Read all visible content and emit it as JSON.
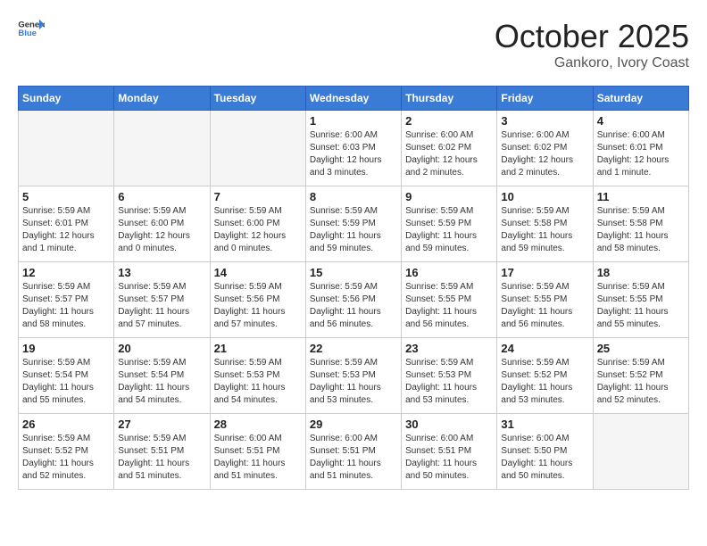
{
  "header": {
    "logo_general": "General",
    "logo_blue": "Blue",
    "month": "October 2025",
    "location": "Gankoro, Ivory Coast"
  },
  "weekdays": [
    "Sunday",
    "Monday",
    "Tuesday",
    "Wednesday",
    "Thursday",
    "Friday",
    "Saturday"
  ],
  "weeks": [
    [
      {
        "day": "",
        "sunrise": "",
        "sunset": "",
        "daylight": "",
        "empty": true
      },
      {
        "day": "",
        "sunrise": "",
        "sunset": "",
        "daylight": "",
        "empty": true
      },
      {
        "day": "",
        "sunrise": "",
        "sunset": "",
        "daylight": "",
        "empty": true
      },
      {
        "day": "1",
        "sunrise": "Sunrise: 6:00 AM",
        "sunset": "Sunset: 6:03 PM",
        "daylight": "Daylight: 12 hours and 3 minutes."
      },
      {
        "day": "2",
        "sunrise": "Sunrise: 6:00 AM",
        "sunset": "Sunset: 6:02 PM",
        "daylight": "Daylight: 12 hours and 2 minutes."
      },
      {
        "day": "3",
        "sunrise": "Sunrise: 6:00 AM",
        "sunset": "Sunset: 6:02 PM",
        "daylight": "Daylight: 12 hours and 2 minutes."
      },
      {
        "day": "4",
        "sunrise": "Sunrise: 6:00 AM",
        "sunset": "Sunset: 6:01 PM",
        "daylight": "Daylight: 12 hours and 1 minute."
      }
    ],
    [
      {
        "day": "5",
        "sunrise": "Sunrise: 5:59 AM",
        "sunset": "Sunset: 6:01 PM",
        "daylight": "Daylight: 12 hours and 1 minute."
      },
      {
        "day": "6",
        "sunrise": "Sunrise: 5:59 AM",
        "sunset": "Sunset: 6:00 PM",
        "daylight": "Daylight: 12 hours and 0 minutes."
      },
      {
        "day": "7",
        "sunrise": "Sunrise: 5:59 AM",
        "sunset": "Sunset: 6:00 PM",
        "daylight": "Daylight: 12 hours and 0 minutes."
      },
      {
        "day": "8",
        "sunrise": "Sunrise: 5:59 AM",
        "sunset": "Sunset: 5:59 PM",
        "daylight": "Daylight: 11 hours and 59 minutes."
      },
      {
        "day": "9",
        "sunrise": "Sunrise: 5:59 AM",
        "sunset": "Sunset: 5:59 PM",
        "daylight": "Daylight: 11 hours and 59 minutes."
      },
      {
        "day": "10",
        "sunrise": "Sunrise: 5:59 AM",
        "sunset": "Sunset: 5:58 PM",
        "daylight": "Daylight: 11 hours and 59 minutes."
      },
      {
        "day": "11",
        "sunrise": "Sunrise: 5:59 AM",
        "sunset": "Sunset: 5:58 PM",
        "daylight": "Daylight: 11 hours and 58 minutes."
      }
    ],
    [
      {
        "day": "12",
        "sunrise": "Sunrise: 5:59 AM",
        "sunset": "Sunset: 5:57 PM",
        "daylight": "Daylight: 11 hours and 58 minutes."
      },
      {
        "day": "13",
        "sunrise": "Sunrise: 5:59 AM",
        "sunset": "Sunset: 5:57 PM",
        "daylight": "Daylight: 11 hours and 57 minutes."
      },
      {
        "day": "14",
        "sunrise": "Sunrise: 5:59 AM",
        "sunset": "Sunset: 5:56 PM",
        "daylight": "Daylight: 11 hours and 57 minutes."
      },
      {
        "day": "15",
        "sunrise": "Sunrise: 5:59 AM",
        "sunset": "Sunset: 5:56 PM",
        "daylight": "Daylight: 11 hours and 56 minutes."
      },
      {
        "day": "16",
        "sunrise": "Sunrise: 5:59 AM",
        "sunset": "Sunset: 5:55 PM",
        "daylight": "Daylight: 11 hours and 56 minutes."
      },
      {
        "day": "17",
        "sunrise": "Sunrise: 5:59 AM",
        "sunset": "Sunset: 5:55 PM",
        "daylight": "Daylight: 11 hours and 56 minutes."
      },
      {
        "day": "18",
        "sunrise": "Sunrise: 5:59 AM",
        "sunset": "Sunset: 5:55 PM",
        "daylight": "Daylight: 11 hours and 55 minutes."
      }
    ],
    [
      {
        "day": "19",
        "sunrise": "Sunrise: 5:59 AM",
        "sunset": "Sunset: 5:54 PM",
        "daylight": "Daylight: 11 hours and 55 minutes."
      },
      {
        "day": "20",
        "sunrise": "Sunrise: 5:59 AM",
        "sunset": "Sunset: 5:54 PM",
        "daylight": "Daylight: 11 hours and 54 minutes."
      },
      {
        "day": "21",
        "sunrise": "Sunrise: 5:59 AM",
        "sunset": "Sunset: 5:53 PM",
        "daylight": "Daylight: 11 hours and 54 minutes."
      },
      {
        "day": "22",
        "sunrise": "Sunrise: 5:59 AM",
        "sunset": "Sunset: 5:53 PM",
        "daylight": "Daylight: 11 hours and 53 minutes."
      },
      {
        "day": "23",
        "sunrise": "Sunrise: 5:59 AM",
        "sunset": "Sunset: 5:53 PM",
        "daylight": "Daylight: 11 hours and 53 minutes."
      },
      {
        "day": "24",
        "sunrise": "Sunrise: 5:59 AM",
        "sunset": "Sunset: 5:52 PM",
        "daylight": "Daylight: 11 hours and 53 minutes."
      },
      {
        "day": "25",
        "sunrise": "Sunrise: 5:59 AM",
        "sunset": "Sunset: 5:52 PM",
        "daylight": "Daylight: 11 hours and 52 minutes."
      }
    ],
    [
      {
        "day": "26",
        "sunrise": "Sunrise: 5:59 AM",
        "sunset": "Sunset: 5:52 PM",
        "daylight": "Daylight: 11 hours and 52 minutes."
      },
      {
        "day": "27",
        "sunrise": "Sunrise: 5:59 AM",
        "sunset": "Sunset: 5:51 PM",
        "daylight": "Daylight: 11 hours and 51 minutes."
      },
      {
        "day": "28",
        "sunrise": "Sunrise: 6:00 AM",
        "sunset": "Sunset: 5:51 PM",
        "daylight": "Daylight: 11 hours and 51 minutes."
      },
      {
        "day": "29",
        "sunrise": "Sunrise: 6:00 AM",
        "sunset": "Sunset: 5:51 PM",
        "daylight": "Daylight: 11 hours and 51 minutes."
      },
      {
        "day": "30",
        "sunrise": "Sunrise: 6:00 AM",
        "sunset": "Sunset: 5:51 PM",
        "daylight": "Daylight: 11 hours and 50 minutes."
      },
      {
        "day": "31",
        "sunrise": "Sunrise: 6:00 AM",
        "sunset": "Sunset: 5:50 PM",
        "daylight": "Daylight: 11 hours and 50 minutes."
      },
      {
        "day": "",
        "sunrise": "",
        "sunset": "",
        "daylight": "",
        "empty": true
      }
    ]
  ]
}
